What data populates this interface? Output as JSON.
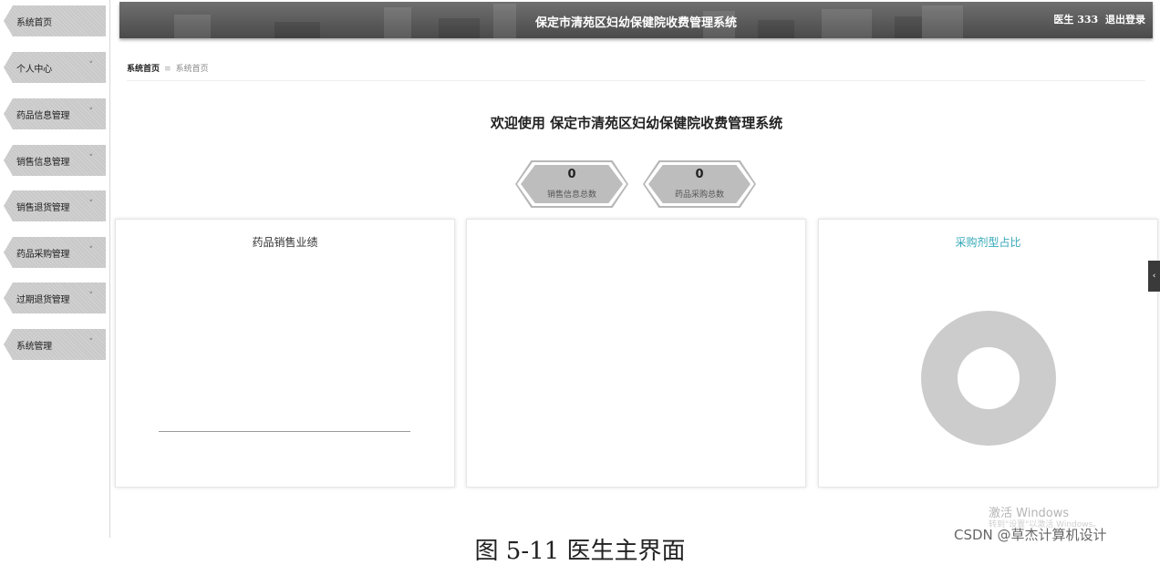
{
  "header": {
    "title": "保定市清苑区妇幼保健院收费管理系统",
    "user": "医生 333",
    "logout": "退出登录"
  },
  "sidebar": {
    "items": [
      {
        "label": "系统首页",
        "has_chevron": false
      },
      {
        "label": "个人中心",
        "has_chevron": true
      },
      {
        "label": "药品信息管理",
        "has_chevron": true
      },
      {
        "label": "销售信息管理",
        "has_chevron": true
      },
      {
        "label": "销售退货管理",
        "has_chevron": true
      },
      {
        "label": "药品采购管理",
        "has_chevron": true
      },
      {
        "label": "过期退货管理",
        "has_chevron": true
      },
      {
        "label": "系统管理",
        "has_chevron": true
      }
    ],
    "chevron": "˅"
  },
  "breadcrumb": {
    "home": "系统首页",
    "separator": "≡",
    "current": "系统首页"
  },
  "welcome": "欢迎使用 保定市清苑区妇幼保健院收费管理系统",
  "stats": [
    {
      "value": "0",
      "label": "销售信息总数"
    },
    {
      "value": "0",
      "label": "药品采购总数"
    }
  ],
  "panels": {
    "sales": {
      "title": "药品销售业绩"
    },
    "middle": {
      "title": ""
    },
    "purchase": {
      "title": "采购剂型占比"
    }
  },
  "edge_toggle": "‹",
  "watermarks": {
    "windows": "激活 Windows",
    "windows_sub": "转到\"设置\"以激活 Windows。",
    "csdn": "CSDN @草杰计算机设计"
  },
  "caption": "图 5-11 医生主界面",
  "colors": {
    "header": "#555555",
    "nav": "#c9c9c9",
    "accent_title": "#35a8b8",
    "donut": "#cccccc"
  }
}
